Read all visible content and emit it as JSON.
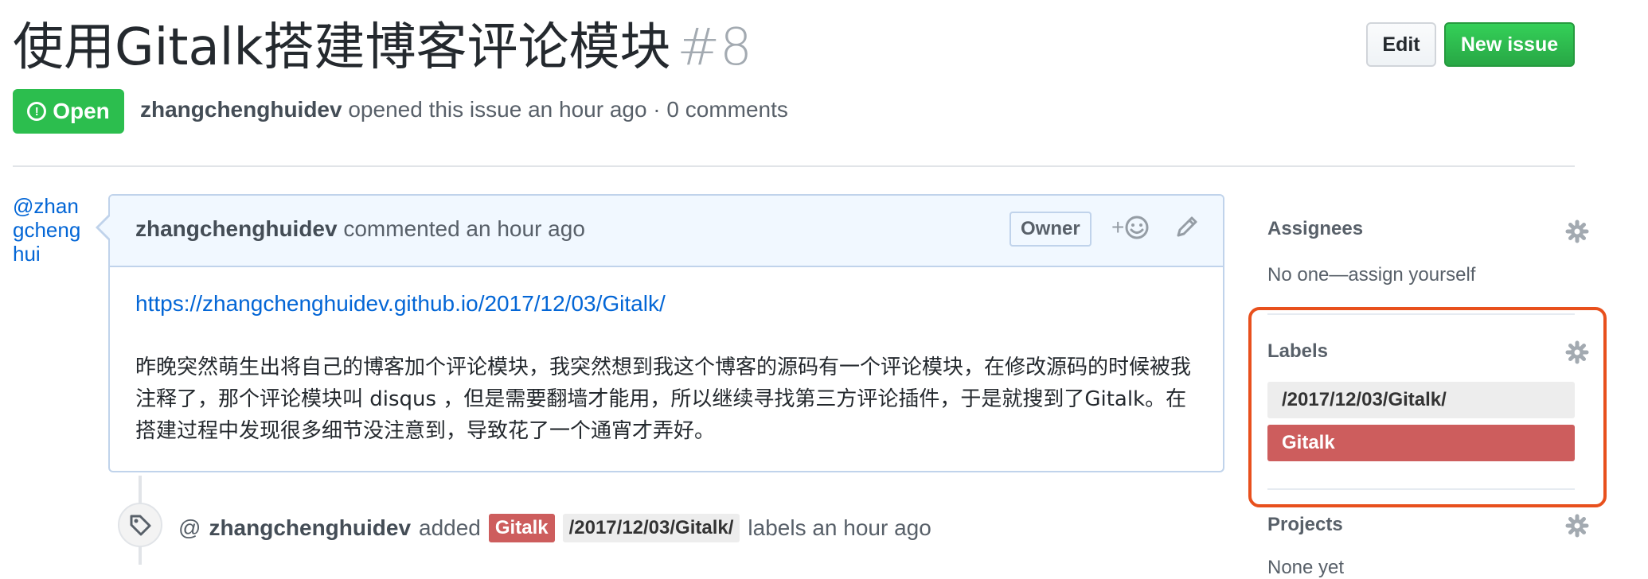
{
  "issue": {
    "title": "使用Gitalk搭建博客评论模块",
    "number": "#8",
    "state": "Open",
    "author": "zhangchenghuidev",
    "meta_text": "opened this issue an hour ago · 0 comments"
  },
  "header_buttons": {
    "edit_label": "Edit",
    "new_issue_label": "New issue"
  },
  "comment": {
    "avatar_alt": "@zhangchenghui",
    "author": "zhangchenghuidev",
    "action": "commented an hour ago",
    "badge": "Owner",
    "reaction_symbol": "+",
    "link": "https://zhangchenghuidev.github.io/2017/12/03/Gitalk/",
    "body": "昨晚突然萌生出将自己的博客加个评论模块，我突然想到我这个博客的源码有一个评论模块，在修改源码的时候被我注释了，那个评论模块叫 disqus ，但是需要翻墙才能用，所以继续寻找第三方评论插件，于是就搜到了Gitalk。在搭建过程中发现很多细节没注意到，导致花了一个通宵才弄好。"
  },
  "timeline_event": {
    "at_symbol": "@",
    "actor": "zhangchenghuidev",
    "verb": "added",
    "label_1": "Gitalk",
    "label_2": "/2017/12/03/Gitalk/",
    "suffix": "labels an hour ago"
  },
  "sidebar": {
    "assignees_heading": "Assignees",
    "assignees_value": "No one—assign yourself",
    "labels_heading": "Labels",
    "labels": [
      {
        "name": "/2017/12/03/Gitalk/",
        "color": "#ededed",
        "text_color": "#333333"
      },
      {
        "name": "Gitalk",
        "color": "#cd5d5d",
        "text_color": "#ffffff"
      }
    ],
    "projects_heading": "Projects",
    "projects_value": "None yet"
  },
  "colors": {
    "open_green": "#2cbe4e",
    "link_blue": "#0366d6",
    "highlight_orange": "#e8501d"
  }
}
